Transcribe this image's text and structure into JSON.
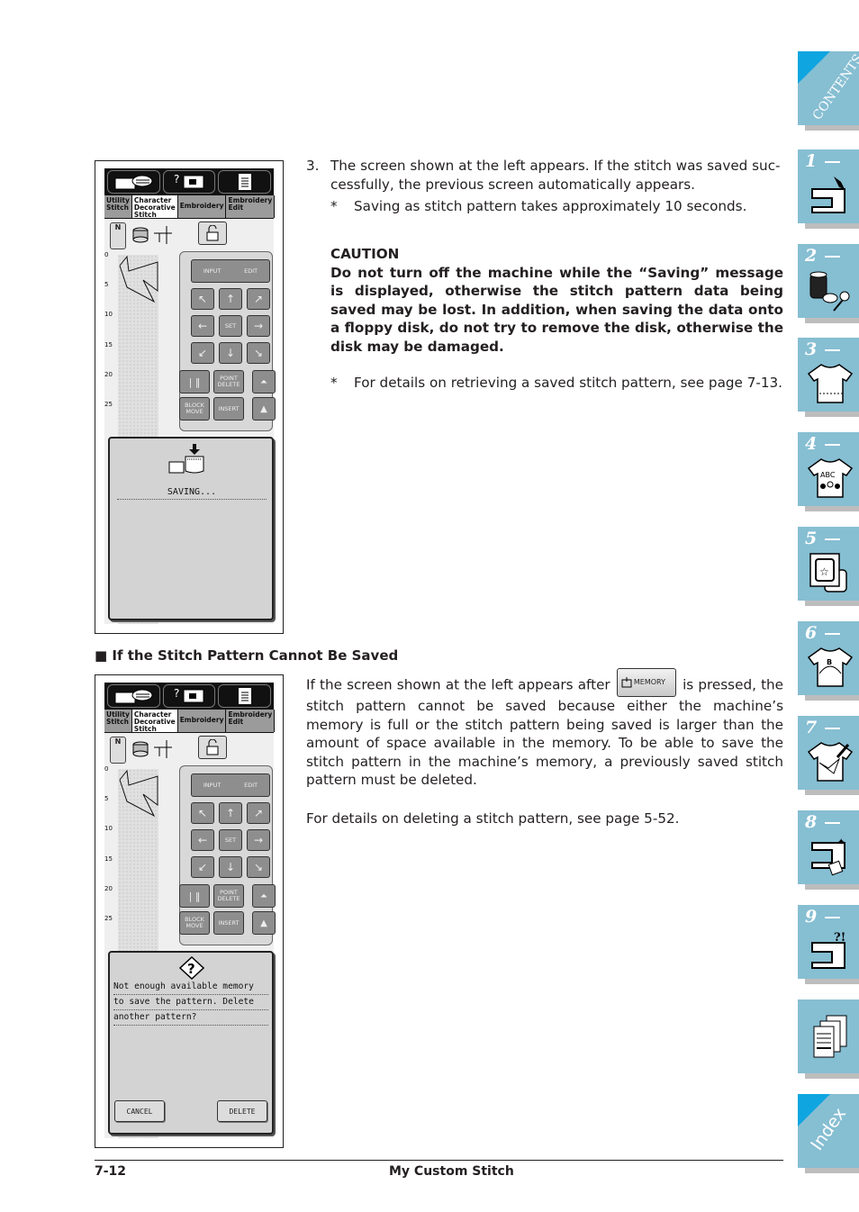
{
  "step3": {
    "number": "3.",
    "text_line1": "The screen shown at the left appears. If the stitch was saved suc-",
    "text_line2": "cessfully, the previous screen automatically appears.",
    "note_marker": "*",
    "note": "Saving as stitch pattern takes approximately 10 seconds."
  },
  "caution": {
    "title": "CAUTION",
    "text": "Do not turn off the machine while the “Saving” message is displayed, otherwise the stitch pattern data being saved may be lost. In addition, when saving the data onto a floppy disk, do not try to remove the disk, otherwise the disk may be damaged.",
    "note_marker": "*",
    "note": "For details on retrieving a saved stitch pattern, see page 7-13."
  },
  "section": {
    "bullet": "■",
    "heading": "If the Stitch Pattern Cannot Be Saved",
    "para1_before": "If the screen shown at the left appears after",
    "memory_button_label": "MEMORY",
    "para1_after": "is pressed, the stitch pattern cannot be saved because either the machine’s memory is full or the stitch pattern being saved is larger than the amount of space available in the memory. To be able to save the stitch pattern in the machine’s memory, a previously saved stitch pattern must be deleted.",
    "para2": "For details on deleting a stitch pattern, see page 5-52."
  },
  "lcd": {
    "tabs": [
      {
        "label": "Utility Stitch",
        "active": false
      },
      {
        "label": "Character Decorative Stitch",
        "active": true
      },
      {
        "label": "Embroidery",
        "active": false
      },
      {
        "label": "Embroidery Edit",
        "active": false
      }
    ],
    "presser_foot": "N",
    "ruler_ticks": [
      "0",
      "5",
      "10",
      "15",
      "20",
      "25"
    ],
    "buttons": {
      "input": "INPUT",
      "edit": "EDIT",
      "set": "SET",
      "point_delete": "POINT DELETE",
      "block_move": "BLOCK MOVE",
      "insert": "INSERT"
    }
  },
  "screen1": {
    "message": "SAVING..."
  },
  "screen2": {
    "message_lines": [
      "Not enough available memory",
      "to save the pattern. Delete",
      "another pattern?"
    ],
    "cancel_label": "CANCEL",
    "delete_label": "DELETE"
  },
  "side_tabs": [
    {
      "label": "CONTENTS",
      "icon": "contents-icon"
    },
    {
      "num": "1",
      "icon": "sewing-machine-icon"
    },
    {
      "num": "2",
      "icon": "thread-spool-scissors-icon"
    },
    {
      "num": "3",
      "icon": "shirt-utility-icon"
    },
    {
      "num": "4",
      "icon": "shirt-abc-icon"
    },
    {
      "num": "5",
      "icon": "embroidery-frame-icon"
    },
    {
      "num": "6",
      "icon": "shirt-edit-icon"
    },
    {
      "num": "7",
      "icon": "shirt-pen-icon"
    },
    {
      "num": "8",
      "icon": "machine-maintenance-icon"
    },
    {
      "num": "9",
      "icon": "machine-troubleshoot-icon"
    },
    {
      "label": "",
      "icon": "documents-icon"
    },
    {
      "label": "Index",
      "icon": "index-icon"
    }
  ],
  "footer": {
    "page_number": "7-12",
    "chapter_title": "My Custom Stitch"
  }
}
